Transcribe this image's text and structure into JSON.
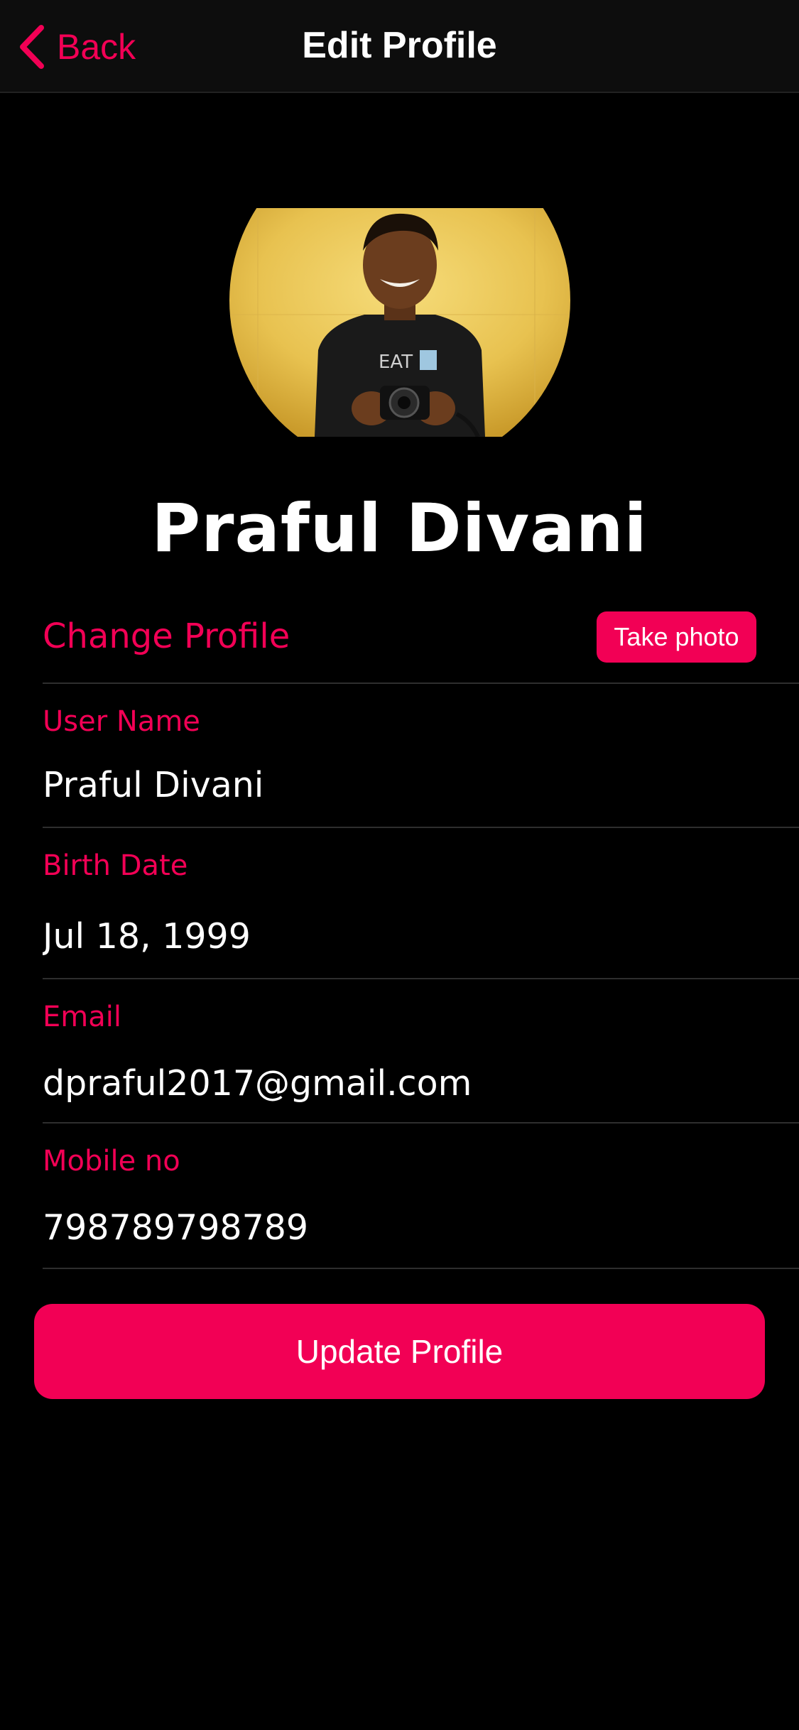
{
  "header": {
    "back_label": "Back",
    "title": "Edit Profile",
    "back_icon": "chevron-left-icon"
  },
  "profile": {
    "name": "Praful Divani",
    "avatar": "profile-photo"
  },
  "change_profile": {
    "label": "Change Profile",
    "take_photo_label": "Take photo"
  },
  "form": {
    "username": {
      "label": "User Name",
      "value": "Praful Divani"
    },
    "birth_date": {
      "label": "Birth Date",
      "value": "Jul 18, 1999"
    },
    "email": {
      "label": "Email",
      "value": "dpraful2017@gmail.com"
    },
    "mobile": {
      "label": "Mobile no",
      "value": "798789798789"
    }
  },
  "actions": {
    "update_label": "Update Profile"
  },
  "colors": {
    "accent": "#f20055",
    "background": "#000000",
    "navbar": "#0d0d0d",
    "divider": "#2e2e2e"
  }
}
